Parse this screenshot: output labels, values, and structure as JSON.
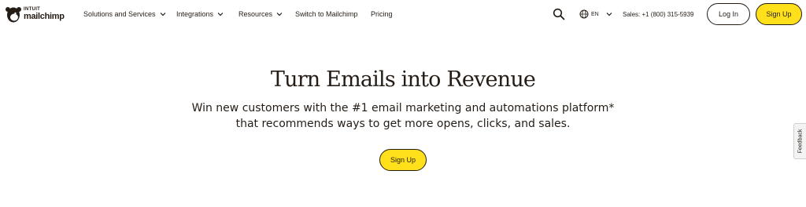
{
  "brand": {
    "line1": "INTUIT",
    "line2": "mailchimp"
  },
  "nav": {
    "items": [
      {
        "label": "Solutions and Services",
        "has_dropdown": true
      },
      {
        "label": "Integrations",
        "has_dropdown": true
      },
      {
        "label": "Resources",
        "has_dropdown": true
      },
      {
        "label": "Switch to Mailchimp",
        "has_dropdown": false
      },
      {
        "label": "Pricing",
        "has_dropdown": false
      }
    ],
    "search_icon": "search-icon",
    "language": {
      "icon": "globe-icon",
      "code": "EN"
    },
    "sales": "Sales: +1 (800) 315-5939",
    "login_label": "Log In",
    "signup_label": "Sign Up"
  },
  "hero": {
    "title": "Turn Emails into Revenue",
    "subtitle_line1": "Win new customers with the #1 email marketing and automations platform*",
    "subtitle_line2": "that recommends ways to get more opens, clicks, and sales.",
    "cta_label": "Sign Up"
  },
  "feedback_tab": "Feedback",
  "colors": {
    "accent": "#ffe01b",
    "text": "#241c15",
    "background": "#ffffff"
  }
}
